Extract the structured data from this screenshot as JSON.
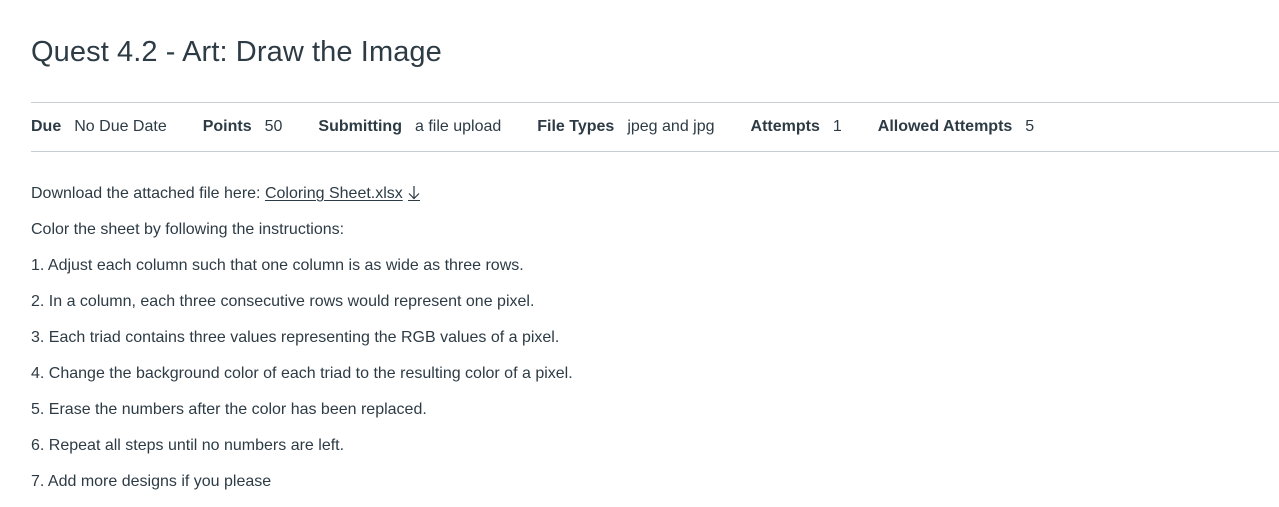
{
  "page": {
    "title": "Quest 4.2 - Art: Draw the Image"
  },
  "details": [
    {
      "label": "Due",
      "value": "No Due Date"
    },
    {
      "label": "Points",
      "value": "50"
    },
    {
      "label": "Submitting",
      "value": "a file upload"
    },
    {
      "label": "File Types",
      "value": "jpeg and jpg"
    },
    {
      "label": "Attempts",
      "value": "1"
    },
    {
      "label": "Allowed Attempts",
      "value": "5"
    }
  ],
  "description": {
    "download_prefix": "Download the attached file here: ",
    "file_link": "Coloring Sheet.xlsx",
    "download_icon": "download-arrow-icon",
    "intro": "Color the sheet by following the instructions:",
    "steps": [
      "1. Adjust each column such that one column is as wide as three rows.",
      "2. In a column, each three consecutive rows would represent one pixel.",
      "3. Each triad contains three values representing the RGB values of a pixel.",
      "4. Change the background color of each triad to the resulting color of a pixel.",
      "5. Erase the numbers after the color has been replaced.",
      "6. Repeat all steps until no numbers are left.",
      "7. Add more designs if you please"
    ]
  },
  "colors": {
    "text": "#2d3b45",
    "divider": "#c7cdd1",
    "background": "#ffffff"
  }
}
